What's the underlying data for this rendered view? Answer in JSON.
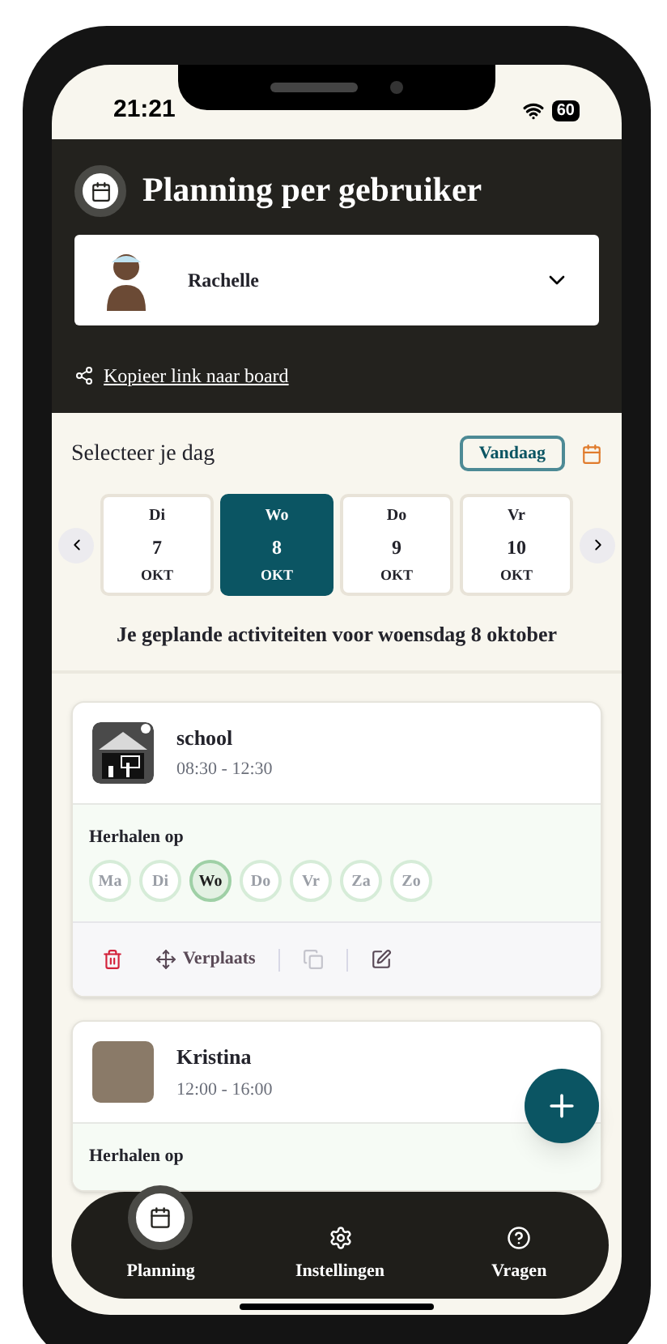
{
  "status_bar": {
    "time": "21:21",
    "battery": "60"
  },
  "header": {
    "title": "Planning per gebruiker",
    "user": {
      "name": "Rachelle"
    },
    "share_link": "Kopieer link naar board"
  },
  "day_picker": {
    "title": "Selecteer je dag",
    "today_button": "Vandaag",
    "days": [
      {
        "weekday": "Di",
        "day": "7",
        "month": "OKT",
        "selected": false
      },
      {
        "weekday": "Wo",
        "day": "8",
        "month": "OKT",
        "selected": true
      },
      {
        "weekday": "Do",
        "day": "9",
        "month": "OKT",
        "selected": false
      },
      {
        "weekday": "Vr",
        "day": "10",
        "month": "OKT",
        "selected": false
      }
    ]
  },
  "activities_heading": "Je geplande activiteiten voor woensdag 8 oktober",
  "activities": [
    {
      "kind": "pictogram",
      "name": "school",
      "time": "08:30 - 12:30",
      "repeat_label": "Herhalen op",
      "repeat_days": [
        {
          "label": "Ma",
          "selected": false
        },
        {
          "label": "Di",
          "selected": false
        },
        {
          "label": "Wo",
          "selected": true
        },
        {
          "label": "Do",
          "selected": false
        },
        {
          "label": "Vr",
          "selected": false
        },
        {
          "label": "Za",
          "selected": false
        },
        {
          "label": "Zo",
          "selected": false
        }
      ],
      "actions": {
        "move": "Verplaats"
      }
    },
    {
      "kind": "photo",
      "name": "Kristina",
      "time": "12:00 - 16:00",
      "repeat_label": "Herhalen op"
    }
  ],
  "bottom_nav": [
    {
      "label": "Planning",
      "selected": true
    },
    {
      "label": "Instellingen",
      "selected": false
    },
    {
      "label": "Vragen",
      "selected": false
    }
  ]
}
